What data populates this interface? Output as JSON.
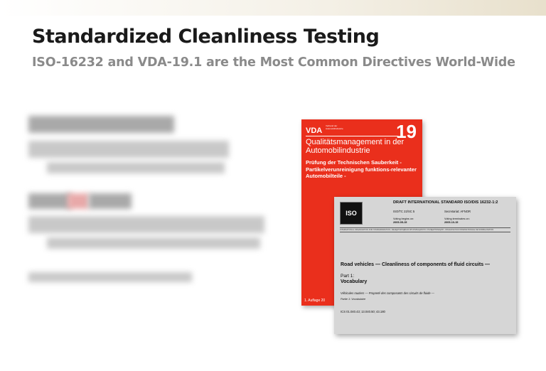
{
  "slide": {
    "title": "Standardized Cleanliness Testing",
    "subtitle": "ISO-16232 and VDA-19.1 are the Most Common Directives World-Wide"
  },
  "vda_cover": {
    "logo": "VDA",
    "logo_sub": "Verband der Automobilindustrie",
    "number": "19",
    "heading": "Qualitätsmanagement in der Automobilindustrie",
    "subheading": "Prüfung der Technischen Sauberkeit - Partikelverunreinigung funktions-relevanter Automobilteile -",
    "footer": "1. Auflage 20"
  },
  "iso_cover": {
    "logo": "ISO",
    "status": "DRAFT INTERNATIONAL STANDARD ISO/DIS 16232-1:2",
    "committee": "ISO/TC 22/SC 5",
    "secretariat": "Secretariat: AFNOR",
    "voting_begins_label": "Voting begins on:",
    "voting_begins": "2005-05-15",
    "voting_ends_label": "Voting terminates on:",
    "voting_ends": "2005-10-15",
    "org_line": "INTERNATIONAL ORGANIZATION FOR STANDARDIZATION • МЕЖДУНАРОДНАЯ ОРГАНИЗАЦИЯ ПО СТАНДАРТИЗАЦИИ • ORGANISATION INTERNATIONALE DE NORMALISATION",
    "title": "Road vehicles — Cleanliness of components of fluid circuits —",
    "part": "Part 1:",
    "part_title": "Vocabulary",
    "title_fr": "Véhicules routiers — Propreté des composants des circuits de fluide —",
    "part_fr": "Partie 1: Vocabulaire",
    "ics": "ICS  01.040.43;  13.040.50;  43.180"
  }
}
